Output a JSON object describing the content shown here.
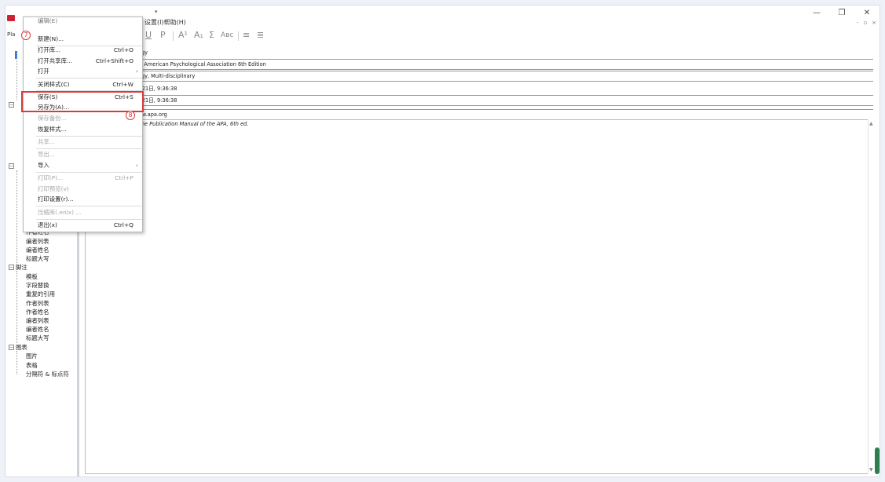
{
  "titlebar": {
    "menubar_text": "设置(I)帮助(H)",
    "minimize": "—",
    "restore": "❐",
    "close": "✕",
    "mdi_controls": [
      "-",
      "▫",
      "×"
    ]
  },
  "toolbar": {
    "style_label": "Pla",
    "buttons": [
      "U",
      "P",
      "A¹",
      "A₁",
      "Σ",
      "Aвс",
      "≡",
      "≣"
    ]
  },
  "tree": {
    "items": [
      "作者姓名",
      "编者列表",
      "编者姓名",
      "标题大写",
      "脚注",
      "模板",
      "字段替换",
      "重复的引用",
      "作者列表",
      "作者姓名",
      "编者列表",
      "编者姓名",
      "标题大写",
      "图表",
      "图片",
      "表格",
      "分隔符 & 标点符"
    ]
  },
  "fields": {
    "f1": "ology",
    "f2": "th - American Psychological Association 6th Edition",
    "f3": "ology, Multi-disciplinary",
    "f4": "9月21日, 9:36:38",
    "f5": "9月21日, 9:36:38",
    "f6": "www.apa.org"
  },
  "editor": {
    "prefix": "n the ",
    "italic": "Publication Manual of the APA, 6th ed."
  },
  "menu": {
    "partial_top": "编辑(E)",
    "items": [
      {
        "label": "新建(N)...",
        "shortcut": ""
      },
      {
        "label": "打开库...",
        "shortcut": "Ctrl+O"
      },
      {
        "label": "打开共享库...",
        "shortcut": "Ctrl+Shift+O"
      },
      {
        "label": "打开",
        "shortcut": ""
      },
      {
        "label": "关闭样式(C)",
        "shortcut": "Ctrl+W"
      },
      {
        "label": "保存(S)",
        "shortcut": "Ctrl+S"
      },
      {
        "label": "另存为(A)...",
        "shortcut": ""
      },
      {
        "label": "保存备份...",
        "shortcut": ""
      },
      {
        "label": "恢复样式...",
        "shortcut": ""
      },
      {
        "label": "共享...",
        "shortcut": ""
      },
      {
        "label": "导出...",
        "shortcut": ""
      },
      {
        "label": "导入",
        "shortcut": ""
      },
      {
        "label": "打印(P)...",
        "shortcut": "Ctrl+P"
      },
      {
        "label": "打印预览(v)",
        "shortcut": ""
      },
      {
        "label": "打印设置(r)...",
        "shortcut": ""
      },
      {
        "label": "压缩库(.enlx) ...",
        "shortcut": ""
      },
      {
        "label": "退出(x)",
        "shortcut": "Ctrl+Q"
      }
    ],
    "arrow": "›"
  },
  "annotations": {
    "step7": "7",
    "step8": "8"
  },
  "colors": {
    "highlight": "#d93b3b",
    "tree_mark": "#2a7de1",
    "scroll_handle": "#2e7d4f"
  }
}
